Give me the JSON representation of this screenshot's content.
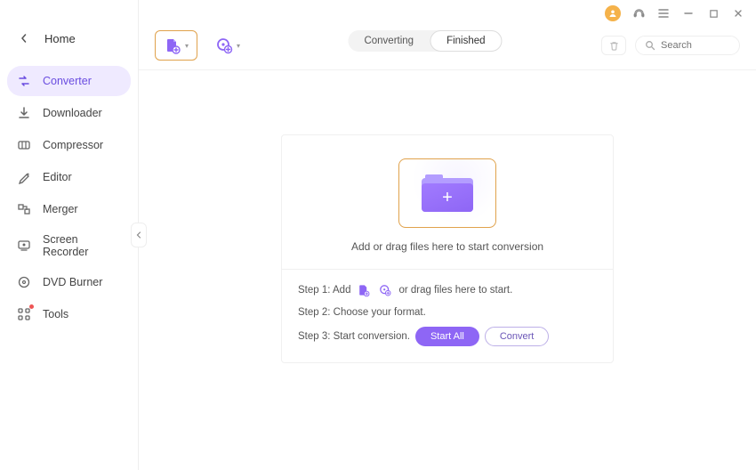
{
  "sidebar": {
    "home_label": "Home",
    "items": [
      {
        "label": "Converter",
        "icon": "converter-icon"
      },
      {
        "label": "Downloader",
        "icon": "downloader-icon"
      },
      {
        "label": "Compressor",
        "icon": "compressor-icon"
      },
      {
        "label": "Editor",
        "icon": "editor-icon"
      },
      {
        "label": "Merger",
        "icon": "merger-icon"
      },
      {
        "label": "Screen Recorder",
        "icon": "screen-recorder-icon"
      },
      {
        "label": "DVD Burner",
        "icon": "dvd-burner-icon"
      },
      {
        "label": "Tools",
        "icon": "tools-icon"
      }
    ],
    "active_index": 0
  },
  "toolbar": {
    "tabs": {
      "converting": "Converting",
      "finished": "Finished",
      "active": "finished"
    },
    "search_placeholder": "Search"
  },
  "drop": {
    "hint": "Add or drag files here to start conversion",
    "step1_prefix": "Step 1: Add",
    "step1_suffix": "or drag files here to start.",
    "step2": "Step 2: Choose your format.",
    "step3": "Step 3: Start conversion.",
    "start_all": "Start All",
    "convert": "Convert"
  }
}
